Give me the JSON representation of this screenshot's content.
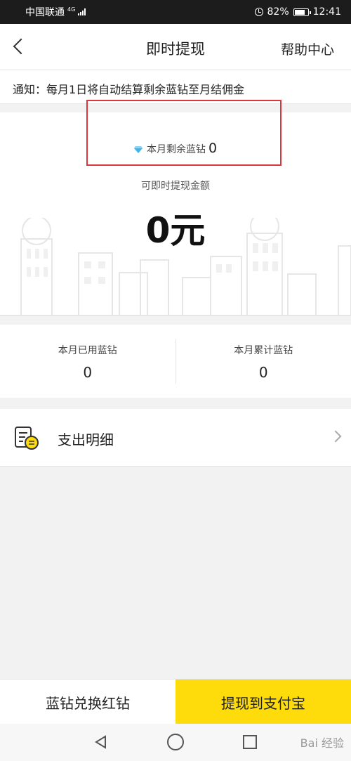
{
  "status_bar": {
    "carrier": "中国联通",
    "network": "4G",
    "battery": "82%",
    "time": "12:41"
  },
  "header": {
    "title": "即时提现",
    "help": "帮助中心"
  },
  "notice": {
    "text": "通知：每月1日将自动结算剩余蓝钻至月结佣金"
  },
  "balance": {
    "remaining_label": "本月剩余蓝钻",
    "remaining_value": "0",
    "available_label": "可即时提现金额",
    "available_amount": "0元"
  },
  "stats": {
    "used_label": "本月已用蓝钻",
    "used_value": "0",
    "total_label": "本月累计蓝钻",
    "total_value": "0"
  },
  "detail": {
    "label": "支出明细"
  },
  "actions": {
    "exchange": "蓝钻兑换红钻",
    "withdraw": "提现到支付宝"
  },
  "watermark": "Bai 经验",
  "colors": {
    "accent_yellow": "#fedc0c",
    "highlight_red": "#d9363e",
    "diamond_blue": "#3fb6e8"
  },
  "icons": [
    "back-icon",
    "diamond-icon",
    "bill-icon",
    "chevron-right-icon",
    "alarm-icon",
    "battery-icon",
    "signal-icon"
  ]
}
